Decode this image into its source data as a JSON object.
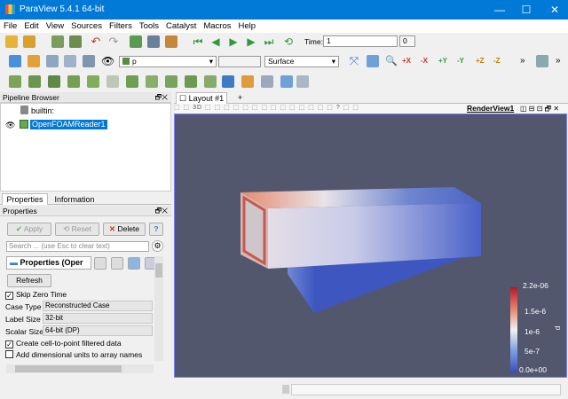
{
  "window": {
    "title": "ParaView 5.4.1 64-bit",
    "min": "—",
    "max": "☐",
    "close": "✕"
  },
  "menu": [
    "File",
    "Edit",
    "View",
    "Sources",
    "Filters",
    "Tools",
    "Catalyst",
    "Macros",
    "Help"
  ],
  "toolbar": {
    "time_label": "Time:",
    "time_value": "1",
    "time_index": "0",
    "array_select": "p",
    "component_select": "",
    "representation": "Surface",
    "more": "»"
  },
  "pipeline": {
    "title": "Pipeline Browser",
    "root": "builtin:",
    "reader": "OpenFOAMReader1"
  },
  "tabs": {
    "properties": "Properties",
    "information": "Information"
  },
  "properties": {
    "title": "Properties",
    "apply": "Apply",
    "reset": "Reset",
    "delete": "Delete",
    "help": "?",
    "search_placeholder": "Search ... (use Esc to clear text)",
    "section": "Properties (Oper",
    "refresh": "Refresh",
    "skip_zero": "Skip Zero Time",
    "case_type_label": "Case Type",
    "case_type_value": "Reconstructed Case",
    "label_size_label": "Label Size",
    "label_size_value": "32-bit",
    "scalar_size_label": "Scalar Size",
    "scalar_size_value": "64-bit (DP)",
    "cell_to_point": "Create cell-to-point filtered data",
    "dim_units": "Add dimensional units to array names"
  },
  "layout": {
    "tab": "Layout #1",
    "add": "+",
    "view_name": "RenderView1"
  },
  "colorbar": {
    "title": "p",
    "labels": [
      "2.2e-06",
      "1.5e-6",
      "1e-6",
      "5e-7",
      "0.0e+00"
    ]
  },
  "colors": {
    "bg": "#52576d",
    "accent": "#0079d7"
  }
}
